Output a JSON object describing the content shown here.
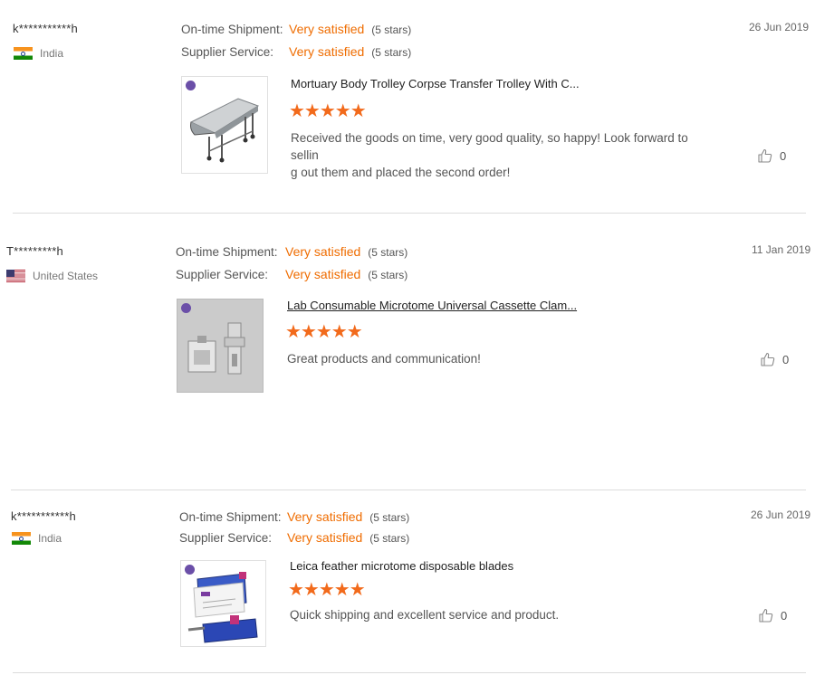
{
  "reviews": [
    {
      "buyer": "k***********h",
      "country": "India",
      "flag": "india-flag",
      "shipment_label": "On-time Shipment:",
      "shipment_value": "Very satisfied",
      "shipment_stars": "(5 stars)",
      "service_label": "Supplier Service:",
      "service_value": "Very satisfied",
      "service_stars": "(5 stars)",
      "date": "26 Jun 2019",
      "product_title": "Mortuary Body Trolley Corpse Transfer Trolley With C...",
      "rating": 5,
      "stars_glyphs": "★★★★★",
      "comment_line1": "Received the goods on time, very good quality, so happy! Look forward to sellin",
      "comment_line2": "g out them and placed the second order!",
      "likes": "0"
    },
    {
      "buyer": "T*********h",
      "country": "United States",
      "flag": "us-flag",
      "shipment_label": "On-time Shipment:",
      "shipment_value": "Very satisfied",
      "shipment_stars": "(5 stars)",
      "service_label": "Supplier Service:",
      "service_value": "Very satisfied",
      "service_stars": "(5 stars)",
      "date": "11 Jan 2019",
      "product_title": "Lab Consumable Microtome Universal Cassette Clam...",
      "rating": 5,
      "stars_glyphs": "★★★★★",
      "comment_line1": "Great products and communication!",
      "likes": "0"
    },
    {
      "buyer": "k***********h",
      "country": "India",
      "flag": "india-flag",
      "shipment_label": "On-time Shipment:",
      "shipment_value": "Very satisfied",
      "shipment_stars": "(5 stars)",
      "service_label": "Supplier Service:",
      "service_value": "Very satisfied",
      "service_stars": "(5 stars)",
      "date": "26 Jun 2019",
      "product_title": "Leica feather microtome disposable blades",
      "rating": 5,
      "stars_glyphs": "★★★★★",
      "comment_line1": "Quick shipping and excellent service and product.",
      "likes": "0"
    }
  ],
  "colors": {
    "accent": "#ef6c00",
    "stars": "#f26a1b",
    "divider": "#dcdcdc"
  },
  "icons": {
    "like": "thumbs-up-icon"
  }
}
